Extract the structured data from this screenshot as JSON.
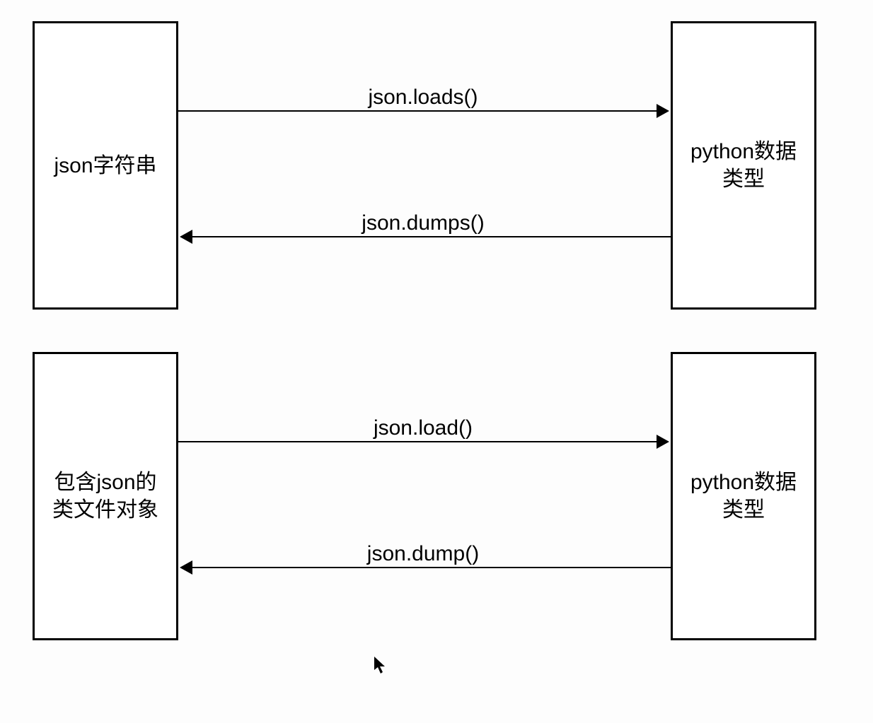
{
  "diagram": {
    "top": {
      "left_box": "json字符串",
      "right_box": "python数据\n类型",
      "arrow_right_label": "json.loads()",
      "arrow_left_label": "json.dumps()"
    },
    "bottom": {
      "left_box": "包含json的\n类文件对象",
      "right_box": "python数据\n类型",
      "arrow_right_label": "json.load()",
      "arrow_left_label": "json.dump()"
    }
  }
}
